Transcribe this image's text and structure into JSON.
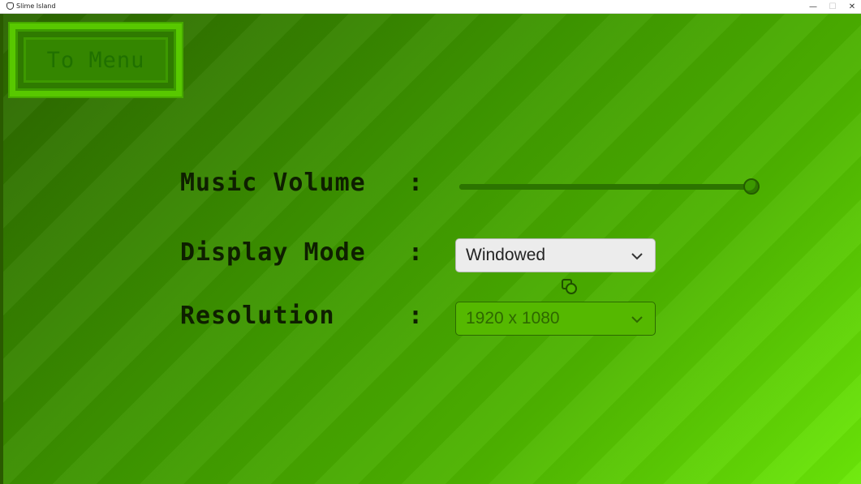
{
  "window": {
    "title": "Slime Island",
    "minimize_glyph": "—",
    "maximize_glyph": "☐",
    "close_glyph": "✕"
  },
  "menu_button": {
    "label": "To Menu"
  },
  "settings": {
    "music_volume": {
      "label": "Music Volume",
      "colon": ":",
      "value": 1.0
    },
    "display_mode": {
      "label": "Display Mode",
      "colon": ":",
      "selected": "Windowed"
    },
    "resolution": {
      "label": "Resolution",
      "colon": ":",
      "selected": "1920 x 1080"
    }
  },
  "colors": {
    "background_dark": "#2b6400",
    "background_light": "#6cea08",
    "text": "#0e1f00",
    "button_border": "#58c800"
  },
  "icons": {
    "dropdown": "chevron-down-icon",
    "cursor": "game-cursor-icon",
    "app": "slime-app-icon"
  }
}
